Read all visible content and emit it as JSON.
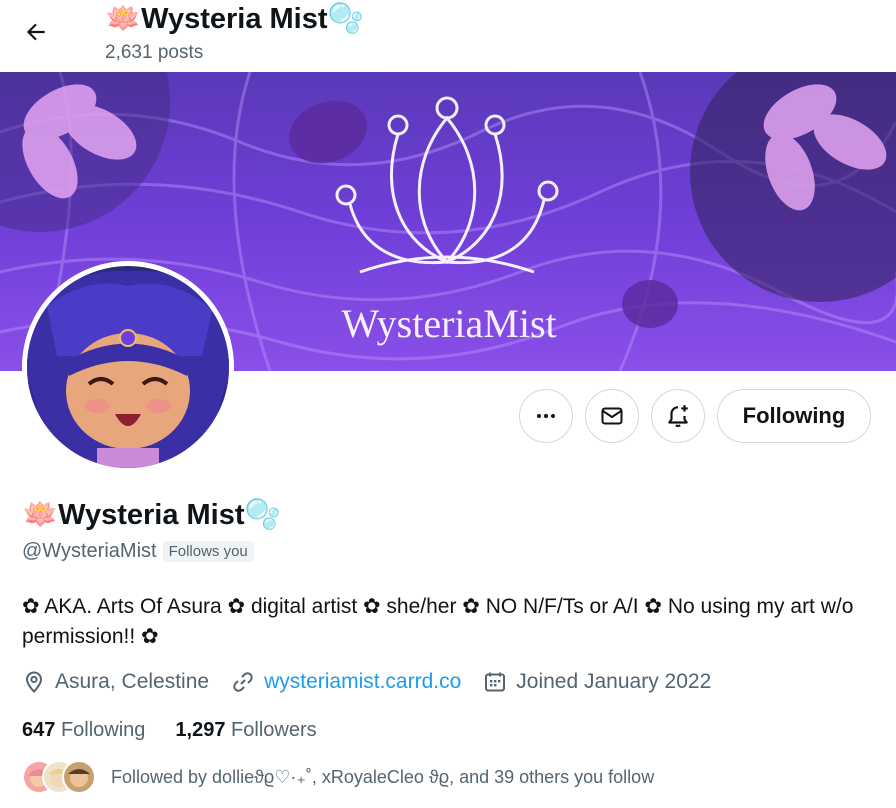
{
  "header": {
    "back_label": "Back",
    "name": "🪷Wysteria Mist🫧",
    "posts": "2,631 posts"
  },
  "banner": {
    "logo_text": "WysteriaMist"
  },
  "actions": {
    "more_icon": "more-horizontal-icon",
    "message_icon": "mail-icon",
    "notify_icon": "bell-plus-icon",
    "follow_label": "Following"
  },
  "profile": {
    "name": "🪷Wysteria Mist🫧",
    "handle": "@WysteriaMist",
    "follows_you": "Follows you",
    "bio": "✿ AKA. Arts Of Asura ✿ digital artist ✿ she/her ✿ NO N/F/Ts or A/I ✿ No using my art w/o permission!! ✿",
    "location": "Asura, Celestine",
    "website": "wysteriamist.carrd.co",
    "joined": "Joined January 2022",
    "following_count": "647",
    "following_label": "Following",
    "followers_count": "1,297",
    "followers_label": "Followers",
    "followed_by": "Followed by dollieϑϱ♡·₊˚, xRoyaleCleo ϑϱ, and 39 others you follow"
  },
  "colors": {
    "accent": "#1d9bf0",
    "muted": "#536471",
    "text": "#0f1419",
    "banner_purple": "#7a3fe0"
  }
}
